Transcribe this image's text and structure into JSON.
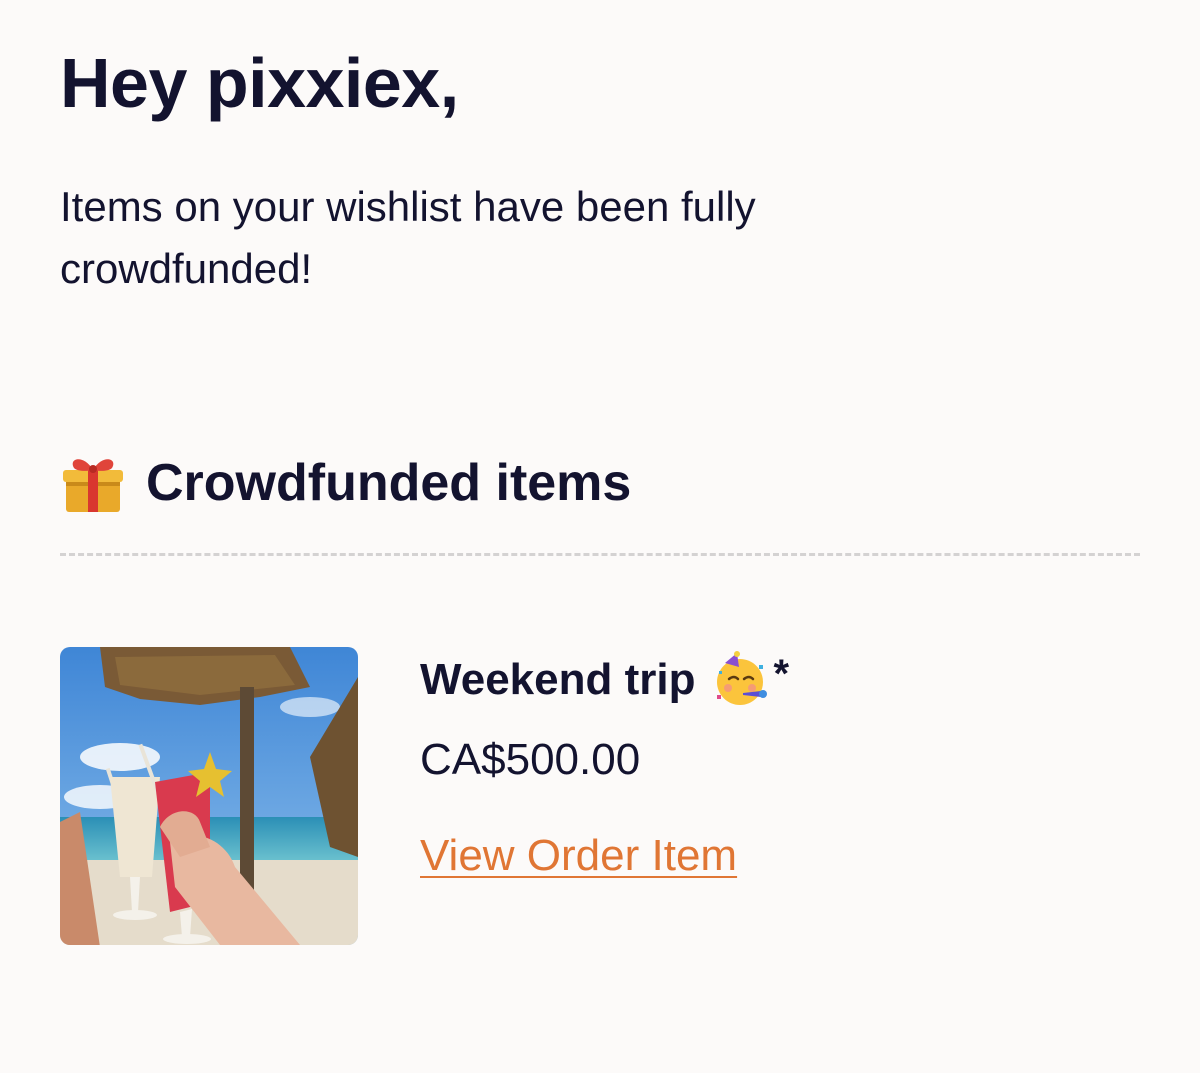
{
  "greeting": "Hey pixxiex,",
  "message": "Items on your wishlist have been fully crowdfunded!",
  "section": {
    "icon": "gift-icon",
    "title": "Crowdfunded items"
  },
  "item": {
    "image": "beach-drinks-photo",
    "name": "Weekend trip",
    "name_icon": "partying-face-icon",
    "name_suffix": "*",
    "price": "CA$500.00",
    "link_label": "View Order Item"
  },
  "colors": {
    "background": "#fcfaf9",
    "text": "#13132f",
    "link": "#e07634",
    "divider": "#d4d2d2"
  }
}
